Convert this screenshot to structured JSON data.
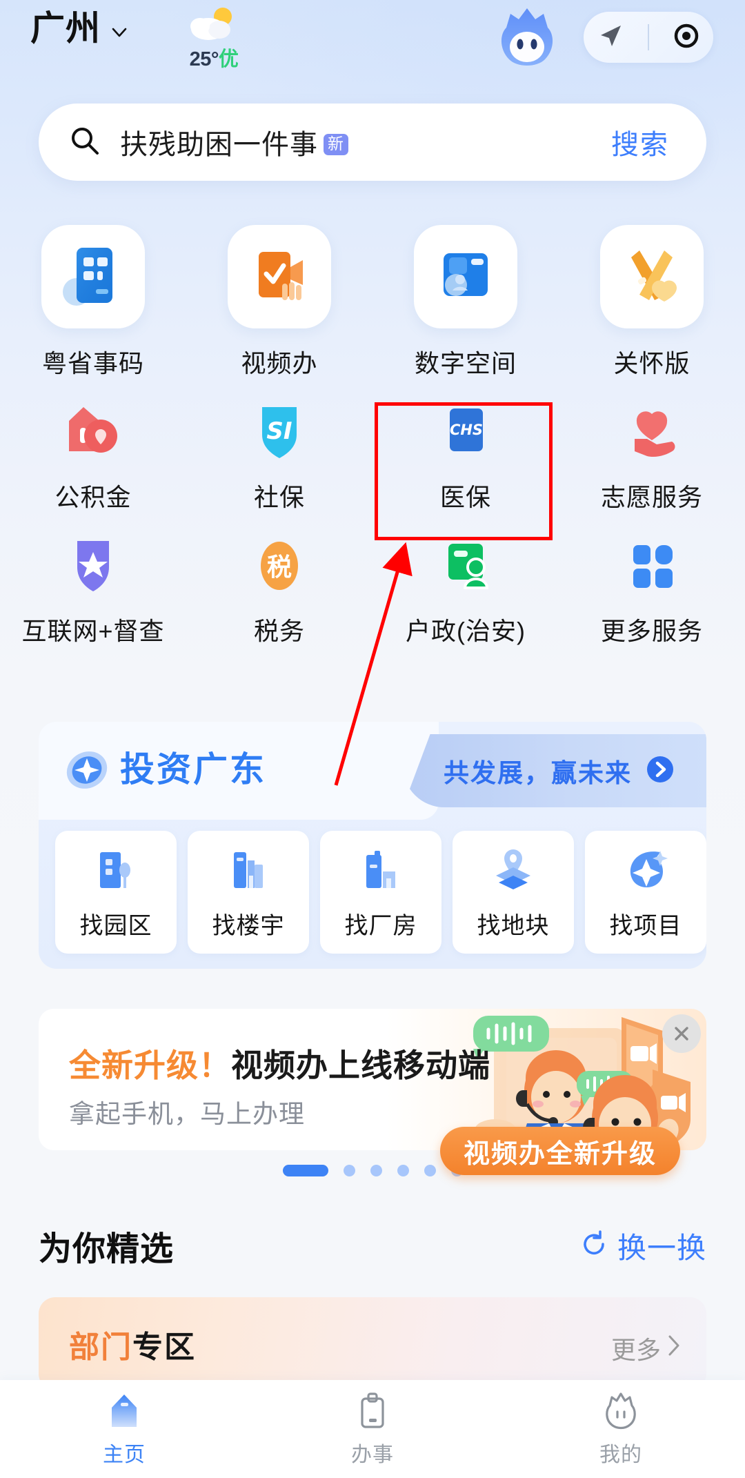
{
  "header": {
    "city": "广州",
    "city_chevron_icon": "chevron-down-icon",
    "weather_icon": "sun-behind-cloud-icon",
    "temperature": "25°",
    "air_quality": "优",
    "mascot_icon": "mascot-avatar-icon",
    "navigate_icon": "navigation-arrow-icon",
    "scan_icon": "scan-target-icon"
  },
  "search": {
    "search_icon": "search-icon",
    "keyword": "扶残助困一件事",
    "tag": "新",
    "button_label": "搜索"
  },
  "grid": {
    "row1": [
      {
        "label": "粤省事码",
        "icon": "qr-code-card-icon"
      },
      {
        "label": "视频办",
        "icon": "video-check-icon"
      },
      {
        "label": "数字空间",
        "icon": "digital-folder-icon"
      },
      {
        "label": "关怀版",
        "icon": "care-ribbon-icon"
      }
    ],
    "row2": [
      {
        "label": "公积金",
        "icon": "house-fund-icon"
      },
      {
        "label": "社保",
        "icon": "si-shield-icon"
      },
      {
        "label": "医保",
        "icon": "chs-card-icon"
      },
      {
        "label": "志愿服务",
        "icon": "heart-hand-icon"
      }
    ],
    "row3": [
      {
        "label": "互联网+督查",
        "icon": "star-shield-icon"
      },
      {
        "label": "税务",
        "icon": "tax-badge-icon"
      },
      {
        "label": "户政(治安)",
        "icon": "id-card-person-icon"
      },
      {
        "label": "更多服务",
        "icon": "grid-more-icon"
      }
    ]
  },
  "invest": {
    "logo_icon": "invest-swirl-icon",
    "title": "投资广东",
    "tab_text": "共发展，赢未来",
    "tab_arrow_icon": "chevron-right-circle-icon",
    "items": [
      {
        "label": "找园区",
        "icon": "park-building-icon"
      },
      {
        "label": "找楼宇",
        "icon": "office-tower-icon"
      },
      {
        "label": "找厂房",
        "icon": "factory-icon"
      },
      {
        "label": "找地块",
        "icon": "land-pin-icon"
      },
      {
        "label": "找项目",
        "icon": "project-star-icon"
      }
    ]
  },
  "banner": {
    "title_highlight": "全新升级！",
    "title_rest": "视频办上线移动端",
    "subtitle": "拿起手机，马上办理",
    "badge": "视频办全新升级",
    "close_icon": "close-icon",
    "illustration_icon": "video-service-agents-illustration",
    "dots_total": 6,
    "dots_active_index": 0
  },
  "section": {
    "title": "为你精选",
    "refresh_icon": "refresh-icon",
    "refresh_label": "换一换"
  },
  "dept_card": {
    "title_orange": "部门",
    "title_black": "专区",
    "more_label": "更多",
    "more_icon": "chevron-right-icon"
  },
  "tabbar": [
    {
      "label": "主页",
      "icon": "home-icon",
      "active": true
    },
    {
      "label": "办事",
      "icon": "clipboard-icon",
      "active": false
    },
    {
      "label": "我的",
      "icon": "profile-mascot-icon",
      "active": false
    }
  ],
  "annotation": {
    "highlight_color": "#ff0000",
    "target_label": "医保"
  }
}
